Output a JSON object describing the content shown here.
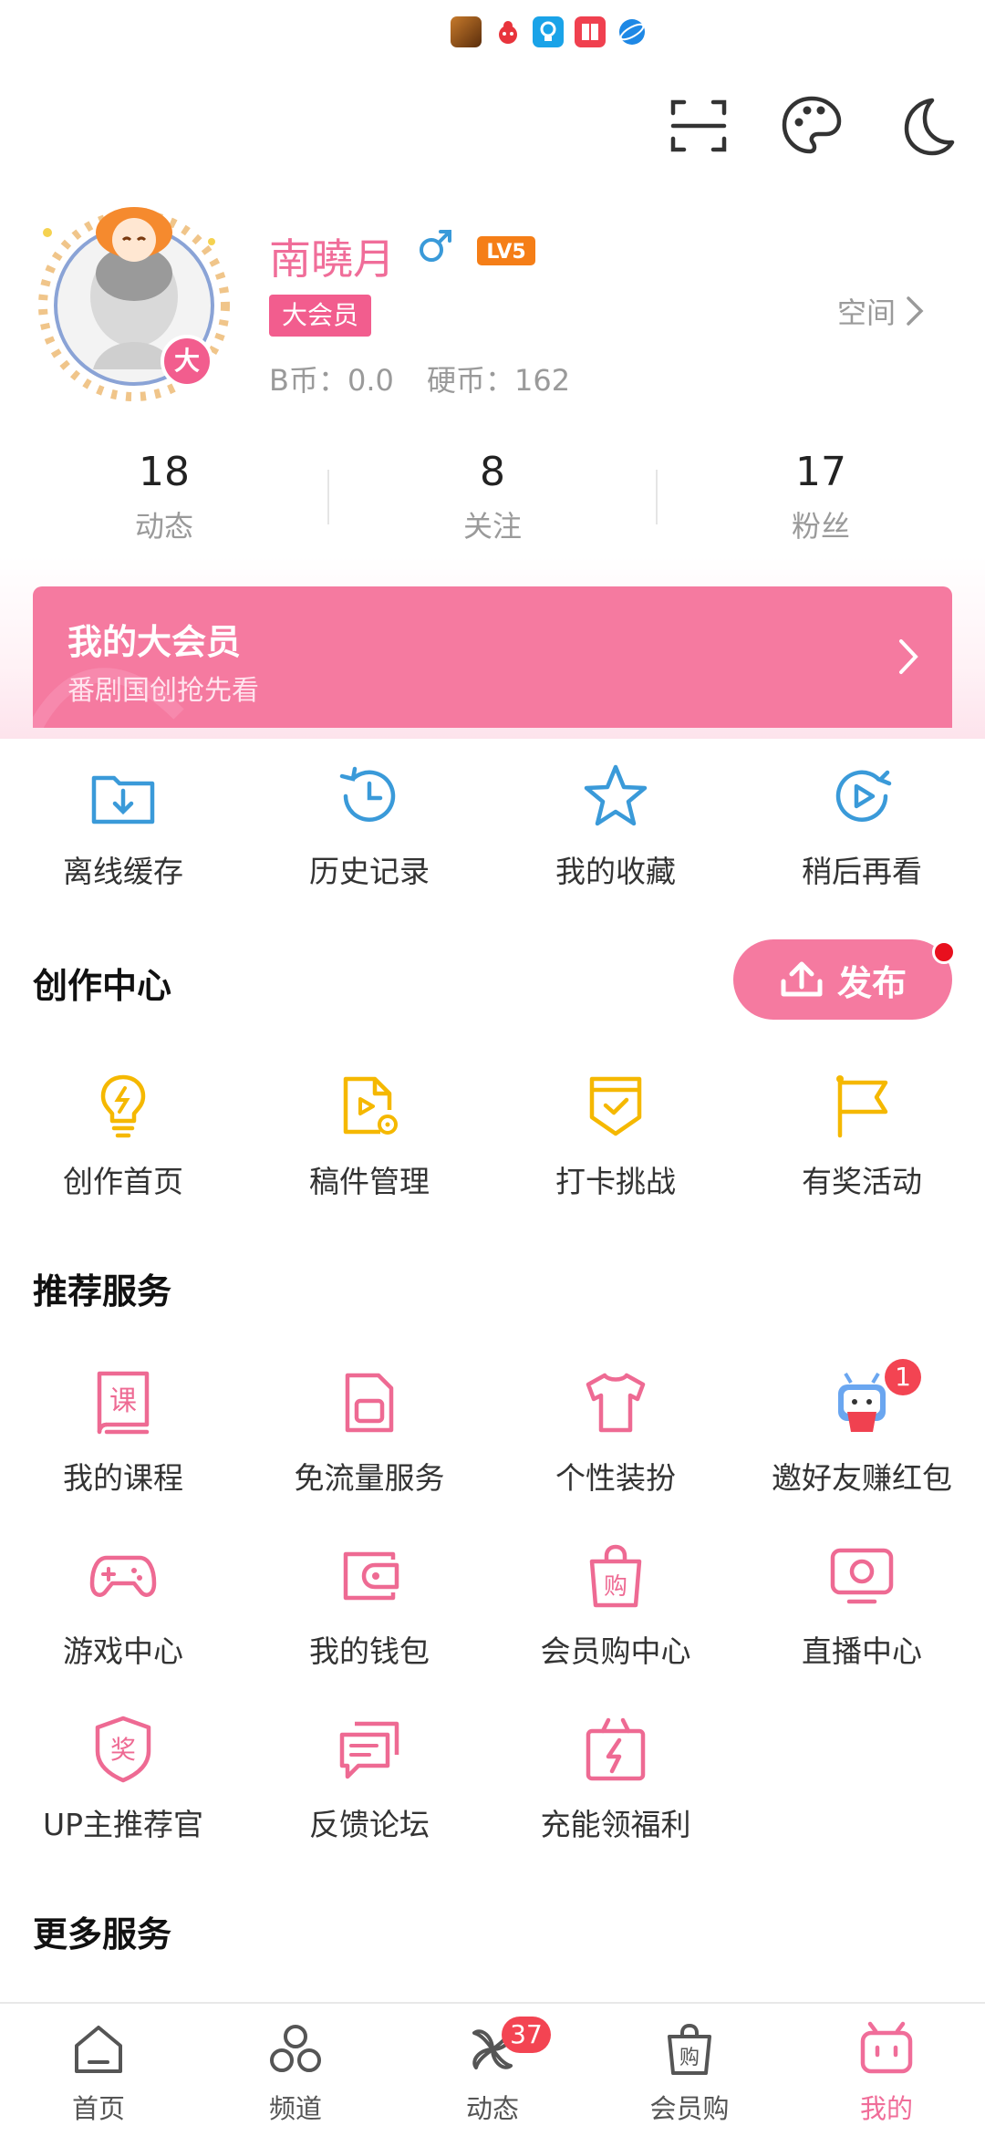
{
  "colors": {
    "accent": "#f57aa0",
    "pink": "#f06d99",
    "blue": "#3a9ad9",
    "gold": "#f5b800",
    "muted": "#9a9a9a"
  },
  "status_bar": {
    "icons": [
      "game-app-icon",
      "red-app-icon",
      "bulb-app-icon",
      "book-app-icon",
      "browser-app-icon"
    ]
  },
  "header": {
    "icons": [
      "scan-icon",
      "palette-icon",
      "night-mode-icon"
    ]
  },
  "profile": {
    "username": "南曉月",
    "gender_icon": "male-icon",
    "level": "LV5",
    "vip_badge": "大会员",
    "avatar_badge": "大",
    "bcoin": "B币：0.0",
    "coin": "硬币：162",
    "space_link": "空间"
  },
  "stats": [
    {
      "value": "18",
      "label": "动态"
    },
    {
      "value": "8",
      "label": "关注"
    },
    {
      "value": "17",
      "label": "粉丝"
    }
  ],
  "vip_banner": {
    "title": "我的大会员",
    "subtitle": "番剧国创抢先看"
  },
  "quick_actions": [
    {
      "label": "离线缓存",
      "icon": "offline-cache-icon"
    },
    {
      "label": "历史记录",
      "icon": "history-icon"
    },
    {
      "label": "我的收藏",
      "icon": "star-icon"
    },
    {
      "label": "稍后再看",
      "icon": "watch-later-icon"
    }
  ],
  "creation": {
    "title": "创作中心",
    "publish_label": "发布",
    "items": [
      {
        "label": "创作首页",
        "icon": "bulb-icon"
      },
      {
        "label": "稿件管理",
        "icon": "manuscript-icon"
      },
      {
        "label": "打卡挑战",
        "icon": "checkin-icon"
      },
      {
        "label": "有奖活动",
        "icon": "flag-icon"
      }
    ]
  },
  "recommend": {
    "title": "推荐服务",
    "items": [
      {
        "label": "我的课程",
        "icon": "course-icon"
      },
      {
        "label": "免流量服务",
        "icon": "sim-card-icon"
      },
      {
        "label": "个性装扮",
        "icon": "tshirt-icon"
      },
      {
        "label": "邀好友赚红包",
        "icon": "invite-mascot-icon",
        "badge": "1"
      },
      {
        "label": "游戏中心",
        "icon": "gamepad-icon"
      },
      {
        "label": "我的钱包",
        "icon": "wallet-icon"
      },
      {
        "label": "会员购中心",
        "icon": "shopping-bag-icon"
      },
      {
        "label": "直播中心",
        "icon": "live-tv-icon"
      },
      {
        "label": "UP主推荐官",
        "icon": "award-icon"
      },
      {
        "label": "反馈论坛",
        "icon": "feedback-icon"
      },
      {
        "label": "充能领福利",
        "icon": "gift-icon"
      }
    ]
  },
  "more": {
    "title": "更多服务"
  },
  "bottom_nav": [
    {
      "label": "首页",
      "icon": "home-icon"
    },
    {
      "label": "频道",
      "icon": "channel-icon"
    },
    {
      "label": "动态",
      "icon": "dynamic-icon",
      "badge": "37"
    },
    {
      "label": "会员购",
      "icon": "mall-bag-icon"
    },
    {
      "label": "我的",
      "icon": "mine-tv-icon",
      "active": true
    }
  ]
}
